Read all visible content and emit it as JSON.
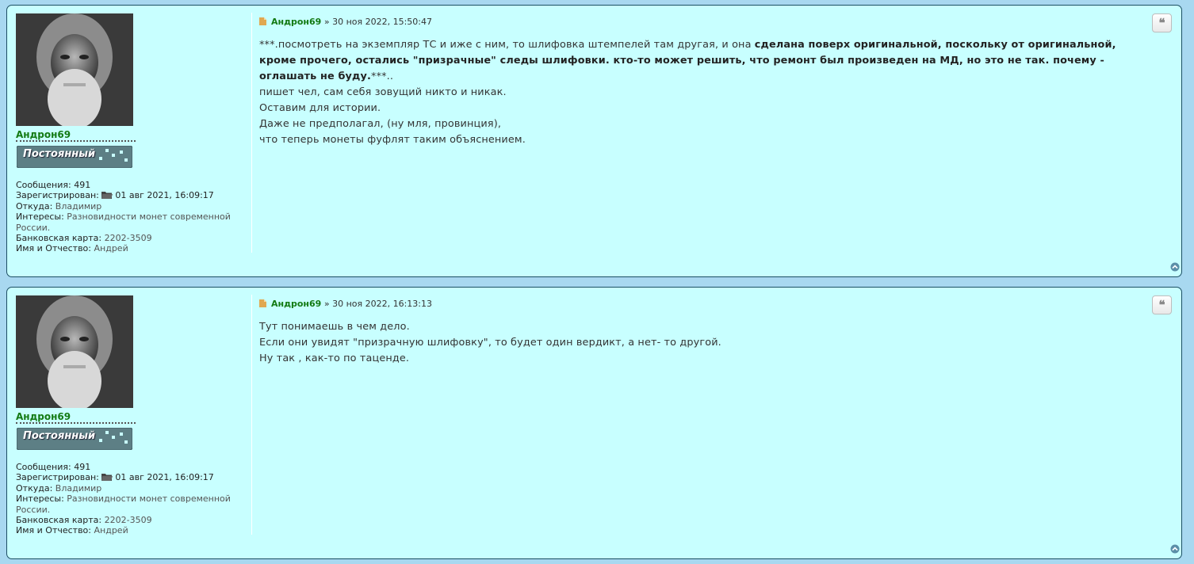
{
  "posts": [
    {
      "username": "Андрон69",
      "rank": "Постоянный",
      "details": {
        "messages_label": "Сообщения:",
        "messages_value": "491",
        "registered_label": "Зарегистрирован:",
        "registered_value": "01 авг 2021, 16:09:17",
        "from_label": "Откуда:",
        "from_value": "Владимир",
        "interests_label": "Интересы:",
        "interests_value": "Разновидности монет современной России.",
        "card_label": "Банковская карта:",
        "card_value": "2202-3509",
        "name_label": "Имя и Отчество:",
        "name_value": "Андрей"
      },
      "author": "Андрон69",
      "date": "» 30 ноя 2022, 15:50:47",
      "content": {
        "p1_normal": "***.посмотреть на экземпляр ТС и иже с ним, то шлифовка штемпелей там другая, и она ",
        "p1_bold": "сделана поверх оригинальной, поскольку от оригинальной, кроме прочего, остались \"призрачные\" следы шлифовки. кто-то может решить, что ремонт был произведен на МД, но это не так. почему - оглашать не буду.",
        "p1_tail": "***..",
        "lines": [
          "пишет чел, сам себя зовущий никто и никак.",
          "Оставим для истории.",
          "Даже не предполагал, (ну мля, провинция),",
          "что теперь монеты фуфлят таким объяснением."
        ]
      },
      "quote_label": "❝"
    },
    {
      "username": "Андрон69",
      "rank": "Постоянный",
      "details": {
        "messages_label": "Сообщения:",
        "messages_value": "491",
        "registered_label": "Зарегистрирован:",
        "registered_value": "01 авг 2021, 16:09:17",
        "from_label": "Откуда:",
        "from_value": "Владимир",
        "interests_label": "Интересы:",
        "interests_value": "Разновидности монет современной России.",
        "card_label": "Банковская карта:",
        "card_value": "2202-3509",
        "name_label": "Имя и Отчество:",
        "name_value": "Андрей"
      },
      "author": "Андрон69",
      "date": "» 30 ноя 2022, 16:13:13",
      "content": {
        "lines": [
          "Тут понимаешь в чем дело.",
          "Если они увидят \"призрачную шлифовку\", то будет один вердикт, а нет- то другой.",
          "Ну так , как-то по таценде."
        ]
      },
      "quote_label": "❝"
    }
  ],
  "colors": {
    "post_bg": "#c8ffff",
    "username": "#137a13",
    "page_bg": "#a8d8f0"
  },
  "icons": {
    "quote": "quote-icon",
    "top": "arrow-up-circle-icon",
    "folder": "folder-icon",
    "post": "post-file-icon"
  }
}
